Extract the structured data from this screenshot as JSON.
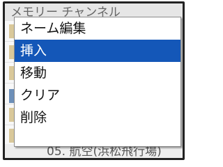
{
  "background_list": {
    "header_text": "メモリー チャンネル",
    "footer_text": "05. 航空(浜松飛行場)"
  },
  "context_menu": {
    "items": [
      {
        "label": "ネーム編集",
        "selected": false
      },
      {
        "label": "挿入",
        "selected": true
      },
      {
        "label": "移動",
        "selected": false
      },
      {
        "label": "クリア",
        "selected": false
      },
      {
        "label": "削除",
        "selected": false
      }
    ]
  },
  "colors": {
    "selection": "#1457b8",
    "frame": "#222222"
  }
}
